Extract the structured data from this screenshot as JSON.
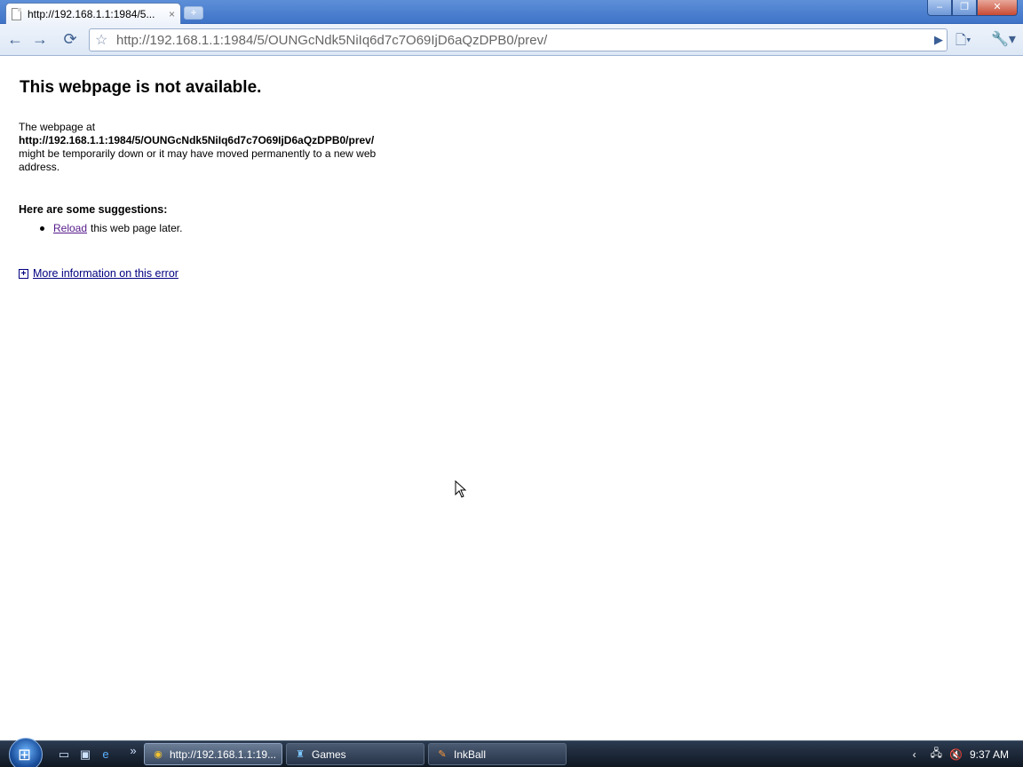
{
  "tab": {
    "title": "http://192.168.1.1:1984/5...",
    "close": "×"
  },
  "newtab": "+",
  "window_buttons": {
    "minimize": "–",
    "maximize": "❐",
    "close": "✕"
  },
  "toolbar": {
    "back": "←",
    "forward": "→",
    "reload": "⟳",
    "star": "☆",
    "address": "http://192.168.1.1:1984/5/OUNGcNdk5NiIq6d7c7O69IjD6aQzDPB0/prev/",
    "go": "▶",
    "page_menu": "🗋▾",
    "wrench_menu": "🔧▾"
  },
  "error": {
    "title": "This webpage is not available.",
    "body_prefix": "The webpage at",
    "url": "http://192.168.1.1:1984/5/OUNGcNdk5NiIq6d7c7O69IjD6aQzDPB0/prev/",
    "body_suffix": "might be temporarily down or it may have moved permanently to a new web address.",
    "suggestions_title": "Here are some suggestions:",
    "reload_link": "Reload",
    "reload_rest": "this web page later.",
    "more_info": "More information on this error"
  },
  "taskbar": {
    "start": "⊞",
    "quicklaunch": [
      "show-desktop",
      "switch-windows",
      "internet-explorer"
    ],
    "overflow": "»",
    "tasks": [
      {
        "label": "http://192.168.1.1:19...",
        "icon": "chrome-icon",
        "active": true
      },
      {
        "label": "Games",
        "icon": "games-icon",
        "active": false
      },
      {
        "label": "InkBall",
        "icon": "inkball-icon",
        "active": false
      }
    ],
    "tray_chevron": "‹",
    "clock": "9:37 AM"
  }
}
